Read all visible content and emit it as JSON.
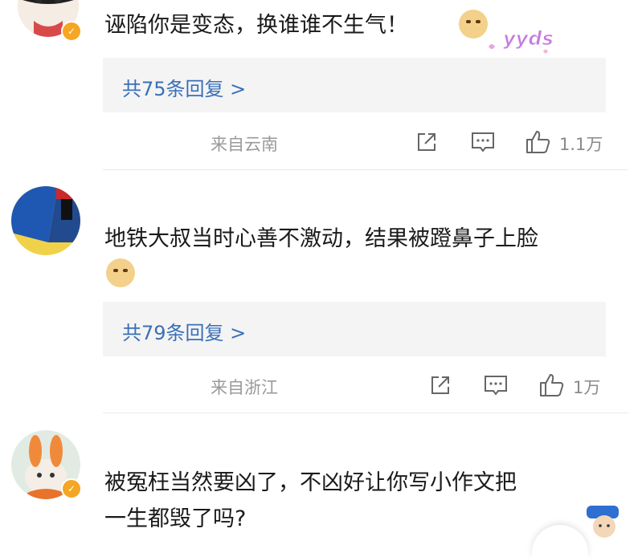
{
  "comments": [
    {
      "text": "诬陷你是变态，换谁谁不生气！",
      "sticker": "yyds",
      "reply_summary": "共75条回复 >",
      "location": "来自云南",
      "likes": "1.1万",
      "verified": true
    },
    {
      "text_line1": "地铁大叔当时心善不激动，结果被蹬鼻子上脸",
      "reply_summary": "共79条回复 >",
      "location": "来自浙江",
      "likes": "1万",
      "verified": false
    },
    {
      "text_line1": "被冤枉当然要凶了，不凶好让你写小作文把",
      "text_line2": "一生都毁了吗?",
      "verified": true
    }
  ],
  "icons": {
    "share": "share-icon",
    "comment": "comment-icon",
    "like": "thumb-up-icon",
    "emoji": "doge-emoji"
  },
  "colors": {
    "reply_link": "#3a6fb6",
    "reply_bg": "#f4f4f5",
    "badge": "#f5a623",
    "meta": "#9a9a9a"
  }
}
